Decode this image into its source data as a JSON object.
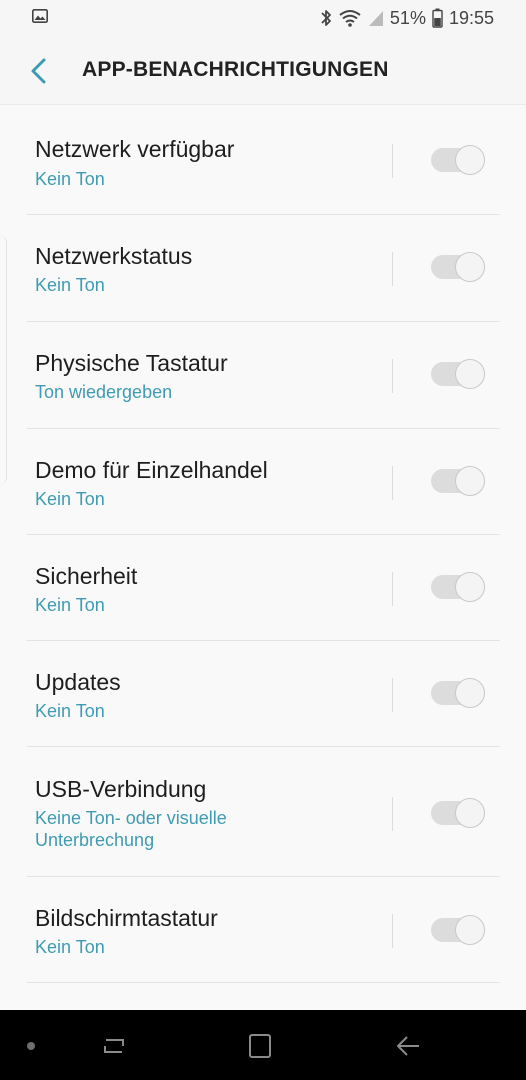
{
  "status_bar": {
    "battery_percent": "51%",
    "time": "19:55",
    "icons": [
      "gallery-icon",
      "bluetooth-icon",
      "wifi-icon",
      "signal-icon",
      "battery-icon"
    ]
  },
  "header": {
    "title": "APP-BENACHRICHTIGUNGEN",
    "back_icon": "chevron-left-icon"
  },
  "colors": {
    "accent": "#3f9bb1",
    "background": "#f6f6f6",
    "title_text": "#1e1e1e",
    "toggle_track": "#dcdcdc"
  },
  "items": [
    {
      "title": "Netzwerk verfügbar",
      "subtitle": "Kein Ton",
      "enabled": false
    },
    {
      "title": "Netzwerkstatus",
      "subtitle": "Kein Ton",
      "enabled": false
    },
    {
      "title": "Physische Tastatur",
      "subtitle": "Ton wiedergeben",
      "enabled": false
    },
    {
      "title": "Demo für Einzelhandel",
      "subtitle": "Kein Ton",
      "enabled": false
    },
    {
      "title": "Sicherheit",
      "subtitle": "Kein Ton",
      "enabled": false
    },
    {
      "title": "Updates",
      "subtitle": "Kein Ton",
      "enabled": false
    },
    {
      "title": "USB-Verbindung",
      "subtitle_line1": "Keine Ton- oder visuelle",
      "subtitle_line2": "Unterbrechung",
      "enabled": false
    },
    {
      "title": "Bildschirmtastatur",
      "subtitle": "Kein Ton",
      "enabled": false
    }
  ],
  "nav_bar": {
    "icons": [
      "nav-dot-icon",
      "recent-apps-icon",
      "home-icon",
      "back-arrow-icon"
    ]
  }
}
